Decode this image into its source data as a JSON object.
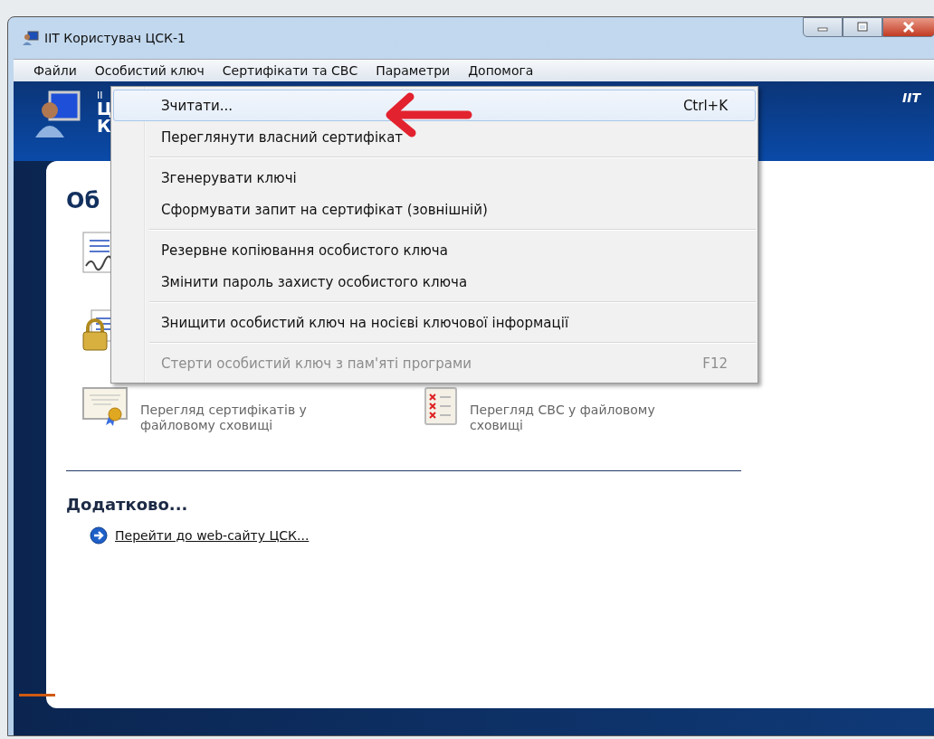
{
  "window": {
    "title": "ІІТ Користувач ЦСК-1"
  },
  "menubar": [
    {
      "label": "Файли"
    },
    {
      "label": "Особистий ключ"
    },
    {
      "label": "Сертифікати та СВС"
    },
    {
      "label": "Параметри"
    },
    {
      "label": "Допомога"
    }
  ],
  "header": {
    "lines": [
      "ІІ",
      "Ц",
      "К"
    ],
    "brand": "IIT"
  },
  "content": {
    "heading": "Об",
    "rows": [
      {
        "left": {
          "kind": "signature"
        }
      },
      {
        "left": {
          "kind": "lock"
        }
      },
      {
        "left": {
          "kind": "certificate",
          "description": "Перегляд сертифікатів у файловому сховищі"
        },
        "right": {
          "kind": "checklist",
          "description": "Перегляд СВС у файловому сховищі"
        }
      }
    ],
    "more": {
      "heading": "Додатково...",
      "link": "Перейти до web-сайту ЦСК..."
    }
  },
  "menu": {
    "groups": [
      [
        {
          "label": "Зчитати...",
          "shortcut": "Ctrl+K",
          "selected": true,
          "disabled": false
        },
        {
          "label": "Переглянути власний сертифікат",
          "selected": false,
          "disabled": false
        }
      ],
      [
        {
          "label": "Згенерувати ключі",
          "selected": false,
          "disabled": false
        },
        {
          "label": "Сформувати запит на сертифікат (зовнішній)",
          "selected": false,
          "disabled": false
        }
      ],
      [
        {
          "label": "Резервне копіювання особистого ключа",
          "selected": false,
          "disabled": false
        },
        {
          "label": "Змінити пароль захисту особистого ключа",
          "selected": false,
          "disabled": false
        }
      ],
      [
        {
          "label": "Знищити особистий ключ на носієві ключової інформації",
          "selected": false,
          "disabled": false
        }
      ],
      [
        {
          "label": "Стерти особистий ключ з пам'яті програми",
          "shortcut": "F12",
          "selected": false,
          "disabled": true
        }
      ]
    ]
  }
}
